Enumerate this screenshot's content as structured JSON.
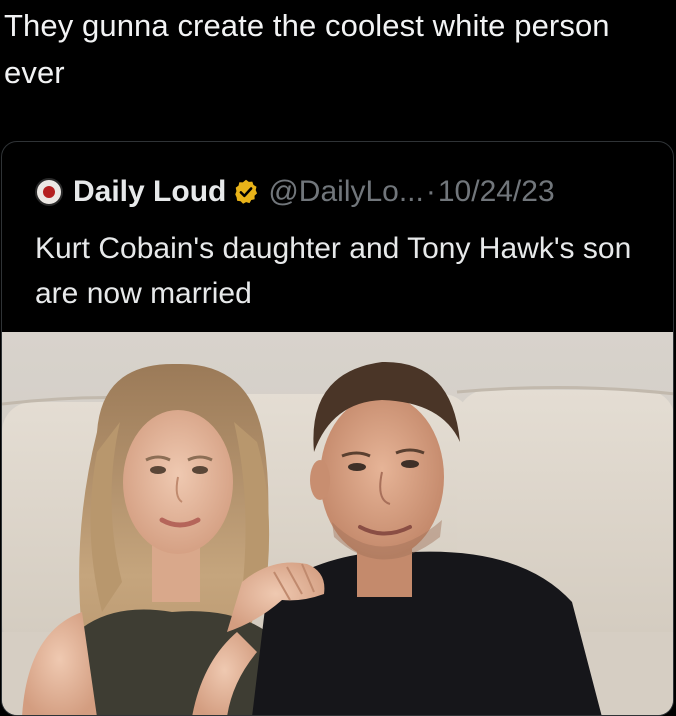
{
  "post": {
    "text": "They gunna create the coolest white person ever"
  },
  "quoted": {
    "display_name": "Daily Loud",
    "handle": "@DailyLo...",
    "separator": "·",
    "date": "10/24/23",
    "text": "Kurt Cobain's daughter and Tony Hawk's son are now married",
    "avatar_icon": "daily-loud-avatar-icon",
    "verified_icon": "verified-badge-icon",
    "verified_color": "#e8b319"
  },
  "photo": {
    "subject": "photo-couple-on-sofa"
  }
}
